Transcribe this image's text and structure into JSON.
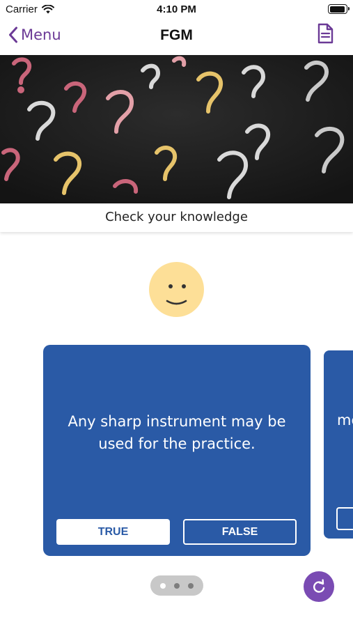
{
  "status_bar": {
    "carrier": "Carrier",
    "time": "4:10 PM"
  },
  "nav": {
    "back_label": "Menu",
    "title": "FGM"
  },
  "hero": {
    "caption": "Check your knowledge"
  },
  "card": {
    "statement": "Any sharp instrument may be used for the practice.",
    "true_label": "TRUE",
    "false_label": "FALSE"
  },
  "next_card": {
    "partial_text": "me"
  },
  "pager": {
    "pages": 3,
    "current": 1
  },
  "colors": {
    "accent": "#6b3a96",
    "card_blue": "#2a5aa6",
    "smiley_yellow": "#fddf97",
    "refresh_purple": "#7a4bb3"
  }
}
